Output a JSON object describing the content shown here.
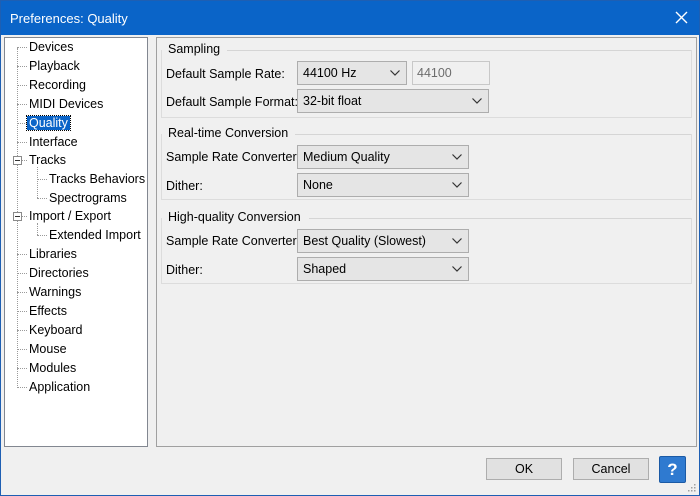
{
  "window": {
    "title": "Preferences: Quality"
  },
  "tree": {
    "items": [
      {
        "label": "Devices"
      },
      {
        "label": "Playback"
      },
      {
        "label": "Recording"
      },
      {
        "label": "MIDI Devices"
      },
      {
        "label": "Quality",
        "selected": true
      },
      {
        "label": "Interface"
      },
      {
        "label": "Tracks",
        "expanded": true
      },
      {
        "label": "Tracks Behaviors"
      },
      {
        "label": "Spectrograms"
      },
      {
        "label": "Import / Export",
        "expanded": true
      },
      {
        "label": "Extended Import"
      },
      {
        "label": "Libraries"
      },
      {
        "label": "Directories"
      },
      {
        "label": "Warnings"
      },
      {
        "label": "Effects"
      },
      {
        "label": "Keyboard"
      },
      {
        "label": "Mouse"
      },
      {
        "label": "Modules"
      },
      {
        "label": "Application"
      }
    ]
  },
  "sampling": {
    "title": "Sampling",
    "rate_label": "Default Sample Rate:",
    "rate_value": "44100 Hz",
    "rate_text": "44100",
    "format_label": "Default Sample Format:",
    "format_value": "32-bit float"
  },
  "realtime": {
    "title": "Real-time Conversion",
    "converter_label": "Sample Rate Converter:",
    "converter_value": "Medium Quality",
    "dither_label": "Dither:",
    "dither_value": "None"
  },
  "highquality": {
    "title": "High-quality Conversion",
    "converter_label": "Sample Rate Converter:",
    "converter_value": "Best Quality (Slowest)",
    "dither_label": "Dither:",
    "dither_value": "Shaped"
  },
  "buttons": {
    "ok": "OK",
    "cancel": "Cancel",
    "help": "?"
  },
  "colors": {
    "titlebar": "#0a64c8",
    "selection": "#0a64c8",
    "help": "#2f7ad0"
  },
  "icons": {
    "close": "close-icon",
    "dropdown": "chevron-down-icon",
    "help": "help-icon",
    "grip": "resize-grip-icon"
  }
}
